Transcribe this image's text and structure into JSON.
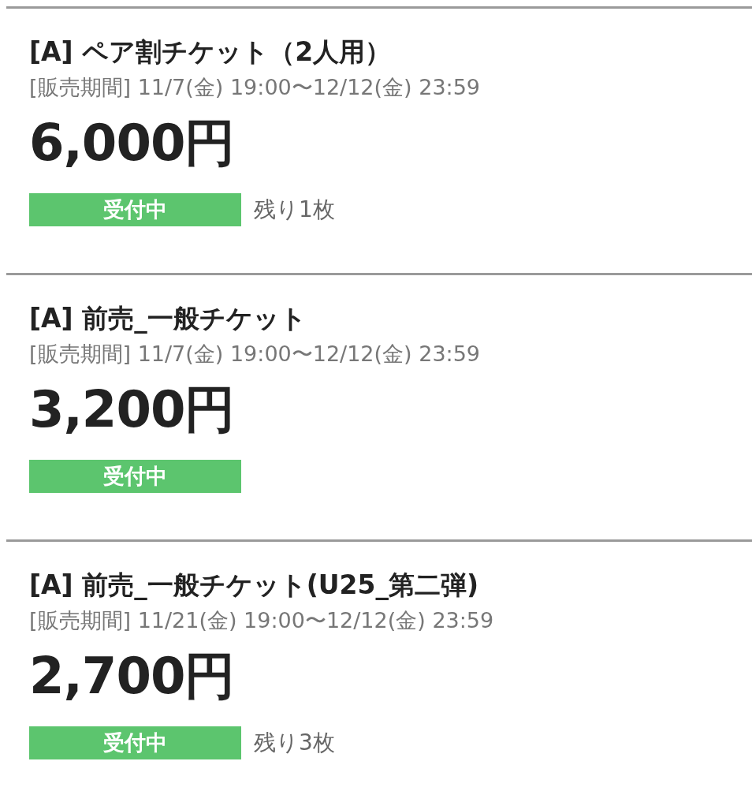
{
  "tickets": [
    {
      "title": "[A] ペア割チケット（2人用）",
      "period": "[販売期間] 11/7(金) 19:00〜12/12(金) 23:59",
      "price": "6,000円",
      "status": "受付中",
      "remaining": "残り1枚"
    },
    {
      "title": "[A] 前売_一般チケット",
      "period": "[販売期間] 11/7(金) 19:00〜12/12(金) 23:59",
      "price": "3,200円",
      "status": "受付中"
    },
    {
      "title": "[A] 前売_一般チケット(U25_第二弾)",
      "period": "[販売期間] 11/21(金) 19:00〜12/12(金) 23:59",
      "price": "2,700円",
      "status": "受付中",
      "remaining": "残り3枚"
    }
  ]
}
